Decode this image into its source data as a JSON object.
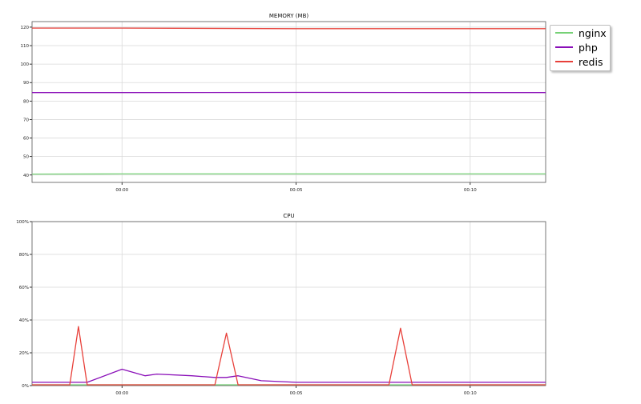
{
  "chart_data": [
    {
      "type": "line",
      "title": "MEMORY (MB)",
      "ylim": [
        36,
        123
      ],
      "yticks": [
        40,
        50,
        60,
        70,
        80,
        90,
        100,
        110,
        120
      ],
      "xlim": [
        "23:57:25",
        "00:12:10"
      ],
      "xticks": [
        "00:00",
        "00:05",
        "00:10"
      ],
      "grid": true,
      "legend_placement": "outside-top-right",
      "series": [
        {
          "name": "nginx",
          "color": "#76d176",
          "x": [
            "23:57:25",
            "00:00:00",
            "00:05:00",
            "00:10:00",
            "00:12:10"
          ],
          "values": [
            40.5,
            40.6,
            40.6,
            40.6,
            40.6
          ]
        },
        {
          "name": "php",
          "color": "#8a0fb8",
          "x": [
            "23:57:25",
            "00:00:00",
            "00:05:00",
            "00:10:00",
            "00:12:10"
          ],
          "values": [
            84.6,
            84.6,
            84.7,
            84.6,
            84.6
          ]
        },
        {
          "name": "redis",
          "color": "#e8403a",
          "x": [
            "23:57:25",
            "00:00:00",
            "00:05:00",
            "00:10:00",
            "00:12:10"
          ],
          "values": [
            119.5,
            119.5,
            119.2,
            119.2,
            119.2
          ]
        }
      ]
    },
    {
      "type": "line",
      "title": "CPU",
      "ylim": [
        0,
        100
      ],
      "yticks": [
        "0%",
        "20%",
        "40%",
        "60%",
        "80%",
        "100%"
      ],
      "xlim": [
        "23:57:25",
        "00:12:10"
      ],
      "xticks": [
        "00:00",
        "00:05",
        "00:10"
      ],
      "grid": true,
      "series": [
        {
          "name": "nginx",
          "color": "#76d176",
          "x": [
            "23:57:25",
            "00:12:10"
          ],
          "values": [
            0.5,
            0.5
          ]
        },
        {
          "name": "php",
          "color": "#8a0fb8",
          "x": [
            "23:57:25",
            "23:58:00",
            "23:59:00",
            "00:00:00",
            "00:00:20",
            "00:00:40",
            "00:01:00",
            "00:02:00",
            "00:02:40",
            "00:03:00",
            "00:03:20",
            "00:04:00",
            "00:05:00",
            "00:06:00",
            "00:07:00",
            "00:08:00",
            "00:09:00",
            "00:10:00",
            "00:11:00",
            "00:12:10"
          ],
          "values": [
            2,
            2,
            2,
            10,
            8,
            6,
            7,
            6,
            5,
            5,
            6,
            3,
            2,
            2,
            2,
            2,
            2,
            2,
            2,
            2
          ]
        },
        {
          "name": "redis",
          "color": "#e8403a",
          "x": [
            "23:57:25",
            "23:58:30",
            "23:58:45",
            "23:59:00",
            "00:02:40",
            "00:03:00",
            "00:03:20",
            "00:07:40",
            "00:08:00",
            "00:08:20",
            "00:12:10"
          ],
          "values": [
            0.5,
            0.5,
            36,
            0.5,
            0.5,
            32,
            0.5,
            0.5,
            35,
            0.5,
            0.5
          ]
        }
      ]
    }
  ]
}
